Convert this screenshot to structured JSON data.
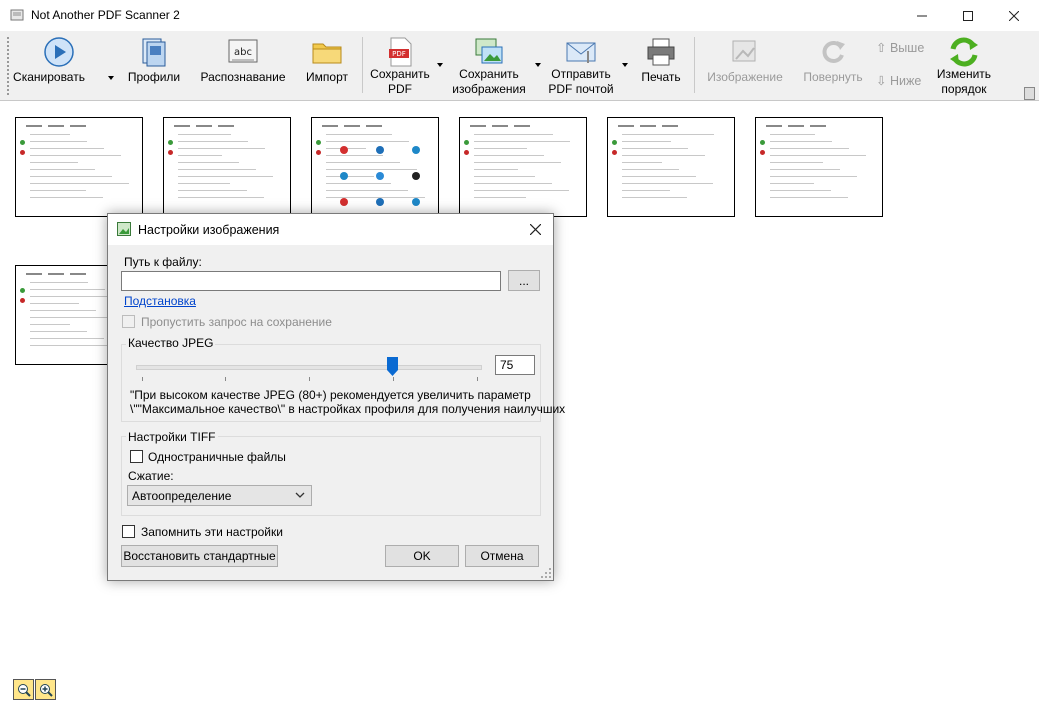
{
  "window": {
    "title": "Not Another PDF Scanner 2"
  },
  "toolbar": {
    "scan": "Сканировать",
    "profiles": "Профили",
    "recognize": "Распознавание",
    "import": "Импорт",
    "save_pdf_l1": "Сохранить",
    "save_pdf_l2": "PDF",
    "save_images_l1": "Сохранить",
    "save_images_l2": "изображения",
    "send_pdf_l1": "Отправить",
    "send_pdf_l2": "PDF почтой",
    "print": "Печать",
    "image": "Изображение",
    "rotate": "Повернуть",
    "move_up": "Выше",
    "move_down": "Ниже",
    "reorder_l1": "Изменить",
    "reorder_l2": "порядок"
  },
  "icons": {
    "scan": "scanner-icon",
    "profiles": "profiles-icon",
    "recognize": "ocr-abc-icon",
    "import": "folder-icon",
    "save_pdf": "pdf-icon",
    "save_images": "images-icon",
    "send_pdf": "email-icon",
    "print": "printer-icon",
    "image": "image-edit-icon",
    "rotate": "rotate-icon",
    "reorder": "reorder-arrows-icon",
    "zoom_out": "zoom-out-icon",
    "zoom_in": "zoom-in-icon"
  },
  "colors": {
    "accent": "#0a6ad2",
    "link": "#0044cc",
    "disabled": "#9a9a9a"
  },
  "dialog": {
    "title": "Настройки изображения",
    "file_path_label": "Путь к файлу:",
    "file_path_value": "",
    "browse_button": "...",
    "placeholders_link": "Подстановка",
    "skip_save_prompt": "Пропустить запрос на сохранение",
    "jpeg_group": "Качество JPEG",
    "jpeg_quality": 75,
    "jpeg_quality_text": "75",
    "jpeg_note_l1": "\"При высоком качестве JPEG (80+) рекомендуется увеличить параметр",
    "jpeg_note_l2": "\\\"\"Максимальное качество\\\" в настройках профиля для получения наилучших",
    "tiff_group": "Настройки TIFF",
    "single_page": "Одностраничные файлы",
    "compression_label": "Сжатие:",
    "compression_value": "Автоопределение",
    "remember": "Запомнить эти настройки",
    "restore_defaults": "Восстановить стандартные",
    "ok": "OK",
    "cancel": "Отмена"
  }
}
